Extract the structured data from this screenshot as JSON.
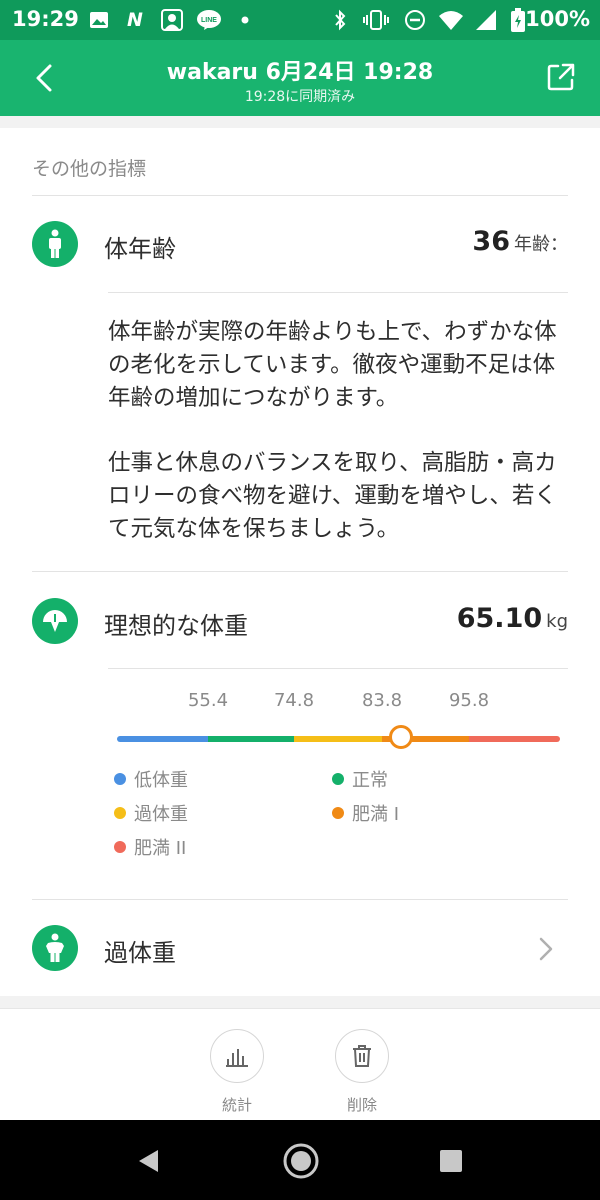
{
  "status_bar": {
    "time": "19:29",
    "n_icon": "N",
    "line_icon": "LINE",
    "battery": "100%",
    "icons": [
      "image-icon",
      "n-app-icon",
      "avatar-icon",
      "line-app-icon",
      "dot-icon",
      "bluetooth-icon",
      "vibrate-icon",
      "dnd-icon",
      "wifi-icon",
      "signal-icon",
      "battery-icon"
    ]
  },
  "header": {
    "title": "wakaru 6月24日 19:28",
    "subtitle": "19:28に同期済み"
  },
  "section": {
    "title": "その他の指標"
  },
  "body_age": {
    "label": "体年齢",
    "value": "36",
    "unit": "年齢：",
    "description_1": "体年齢が実際の年齢よりも上で、わずかな体の老化を示しています。徹夜や運動不足は体年齢の増加につながります。",
    "description_2": "仕事と休息のバランスを取り、高脂肪・高カロリーの食べ物を避け、運動を増やし、若くて元気な体を保ちましょう。"
  },
  "ideal_weight": {
    "label": "理想的な体重",
    "value": "65.10",
    "unit": "kg",
    "ticks": [
      "55.4",
      "74.8",
      "83.8",
      "95.8"
    ],
    "marker_position_fraction": 0.64,
    "legend": [
      {
        "label": "低体重",
        "color": "#4a90e2"
      },
      {
        "label": "正常",
        "color": "#14b06a"
      },
      {
        "label": "過体重",
        "color": "#f5be18"
      },
      {
        "label": "肥満 I",
        "color": "#f08a16"
      },
      {
        "label": "肥満 II",
        "color": "#f06a5a"
      }
    ]
  },
  "overweight_row": {
    "label": "過体重"
  },
  "bottom_bar": {
    "stats_label": "統計",
    "delete_label": "削除"
  },
  "colors": {
    "status_bar": "#0f9a5b",
    "app_bar": "#19b46f",
    "accent": "#14b06a"
  }
}
